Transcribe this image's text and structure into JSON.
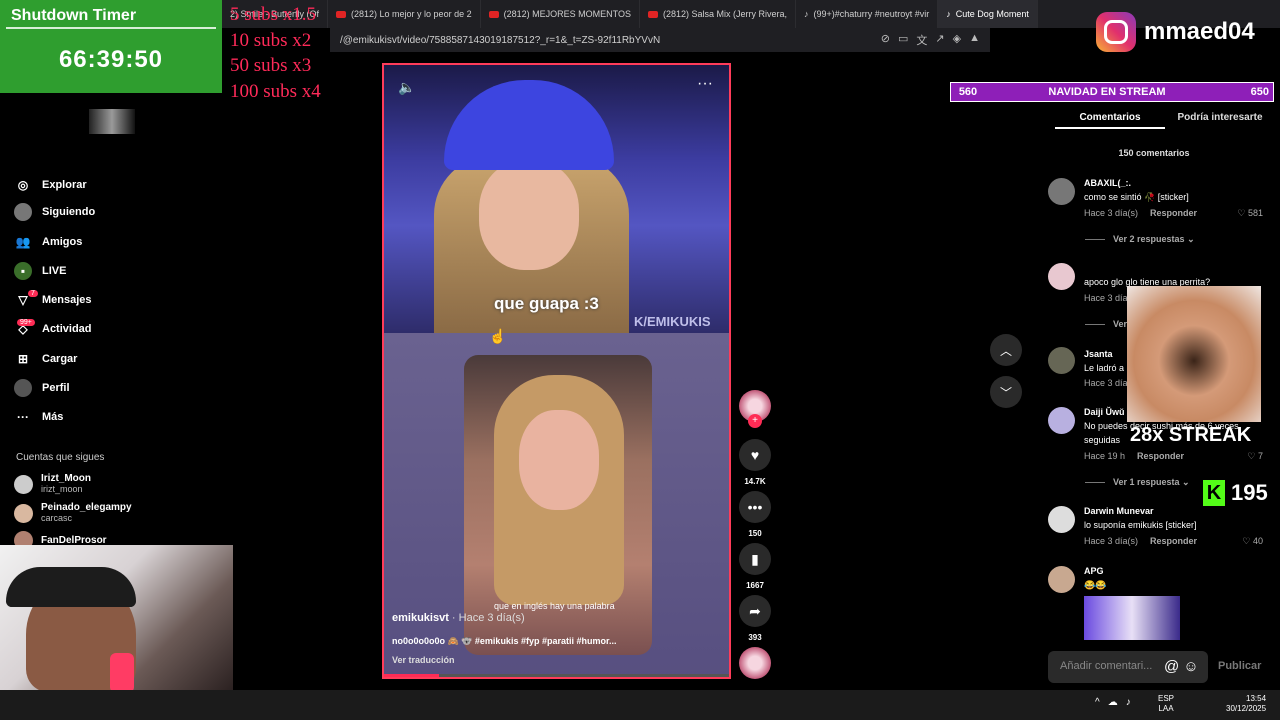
{
  "browser": {
    "tabs": [
      {
        "label": "2) Smile - Butterfly (Of"
      },
      {
        "label": "(2812) Lo mejor y lo peor de 2"
      },
      {
        "label": "(2812) MEJORES MOMENTOS"
      },
      {
        "label": "(2812) Salsa Mix (Jerry Rivera,"
      },
      {
        "label": "(99+)#chaturry #neutroyt #vir"
      },
      {
        "label": "Cute Dog Moment"
      }
    ],
    "url": "/@emikukisvt/video/7588587143019187512?_r=1&_t=ZS-92f11RbYVvN"
  },
  "overlay": {
    "timer_title": "Shutdown Timer",
    "timer_value": "66:39:50",
    "subs_lines": [
      "5 subs x1.5",
      "10 subs x2",
      "50 subs x3",
      "100 subs x4"
    ],
    "instagram_handle": "mmaed04",
    "goal_left": "560",
    "goal_title": "NAVIDAD EN STREAM",
    "goal_right": "650",
    "streak": "28x STREAK",
    "kick_count": "195"
  },
  "sidebar": {
    "items": [
      {
        "label": "Explorar",
        "icon": "compass-icon"
      },
      {
        "label": "Siguiendo",
        "icon": "avatar"
      },
      {
        "label": "Amigos",
        "icon": "friends-icon"
      },
      {
        "label": "LIVE",
        "icon": "live-icon"
      },
      {
        "label": "Mensajes",
        "icon": "messages-icon",
        "badge": "7"
      },
      {
        "label": "Actividad",
        "icon": "activity-icon",
        "badge": "99+"
      },
      {
        "label": "Cargar",
        "icon": "upload-icon"
      },
      {
        "label": "Perfil",
        "icon": "profile-icon"
      },
      {
        "label": "Más",
        "icon": "more-icon"
      }
    ],
    "following_title": "Cuentas que sigues",
    "following": [
      {
        "name": "Irizt_Moon",
        "handle": "irizt_moon"
      },
      {
        "name": "Peinado_elegampy",
        "handle": "carcasc"
      },
      {
        "name": "FanDelProsor",
        "handle": ""
      }
    ]
  },
  "video": {
    "caption_top": "que guapa :3",
    "watermark": "K/EMIKUKIS",
    "subtitle": "que en inglés hay una palabra",
    "author": "emikukisvt",
    "time": " · Hace 3 día(s)",
    "description": "no0o0o0o0o 🙈 🐨 #emikukis #fyp #paratii #humor...",
    "translate": "Ver traducción",
    "progress": 0.16
  },
  "actions": {
    "likes": "14.7K",
    "comments": "150",
    "saves": "1667",
    "shares": "393"
  },
  "comments": {
    "tab_comments": "Comentarios",
    "tab_interest": "Podría interesarte",
    "count": "150 comentarios",
    "list": [
      {
        "user": "ABAXIL(_:.",
        "text": "como se sintió 🥀 [sticker]",
        "time": "Hace 3 día(s)",
        "reply": "Responder",
        "likes": "581",
        "more": "Ver 2 respuestas"
      },
      {
        "user": "",
        "text": "apoco glo glo tiene una perrita?",
        "time": "Hace 3 día",
        "reply": "",
        "likes": "",
        "more": "Ver"
      },
      {
        "user": "Jsanta",
        "text": "Le ladró a",
        "time": "Hace 3 día",
        "reply": "",
        "likes": "",
        "more": ""
      },
      {
        "user": "Daiji Ŭwŭ",
        "text": "No puedes decir sushi más de 6 veces",
        "text2": "seguidas",
        "time": "Hace 19 h",
        "reply": "Responder",
        "likes": "7",
        "more": "Ver 1 respuesta"
      },
      {
        "user": "Darwin Munevar",
        "text": "lo suponía emikukis [sticker]",
        "time": "Hace 3 día(s)",
        "reply": "Responder",
        "likes": "40",
        "more": ""
      },
      {
        "user": "APG",
        "text": "😂😂",
        "time": "",
        "reply": "",
        "likes": "",
        "more": ""
      }
    ],
    "input_placeholder": "Añadir comentari...",
    "post_label": "Publicar"
  },
  "taskbar": {
    "lang1": "ESP",
    "lang2": "LAA",
    "time": "13:54",
    "date": "30/12/2025"
  }
}
